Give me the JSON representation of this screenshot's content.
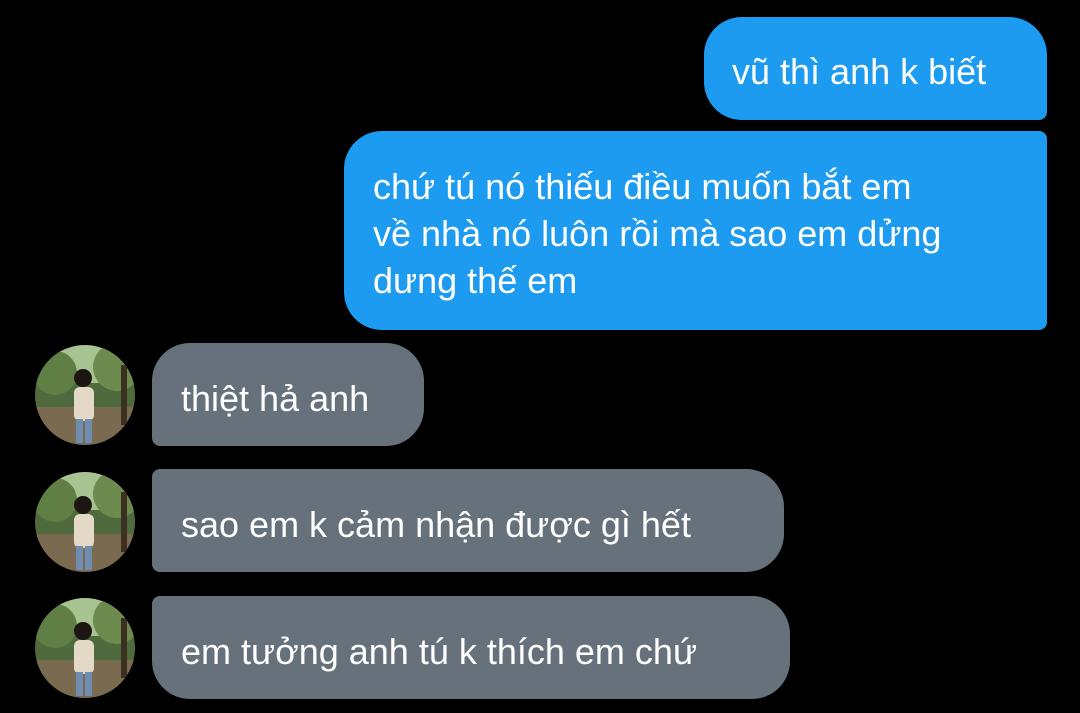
{
  "conversation": {
    "messages": [
      {
        "direction": "outgoing",
        "text": "vũ thì anh k biết"
      },
      {
        "direction": "outgoing",
        "text": "chứ tú nó thiếu điều muốn bắt em\nvề nhà nó luôn rồi mà sao em dửng\ndưng thế em"
      },
      {
        "direction": "incoming",
        "text": "thiệt hả anh",
        "avatar_icon": "person-photo-avatar"
      },
      {
        "direction": "incoming",
        "text": "sao em k cảm nhận được gì hết",
        "avatar_icon": "person-photo-avatar"
      },
      {
        "direction": "incoming",
        "text": "em tưởng anh tú k thích em chứ",
        "avatar_icon": "person-photo-avatar"
      }
    ]
  },
  "colors": {
    "background": "#000000",
    "outgoing_bubble": "#1d9bf0",
    "incoming_bubble": "#67717c",
    "text": "#ffffff"
  }
}
